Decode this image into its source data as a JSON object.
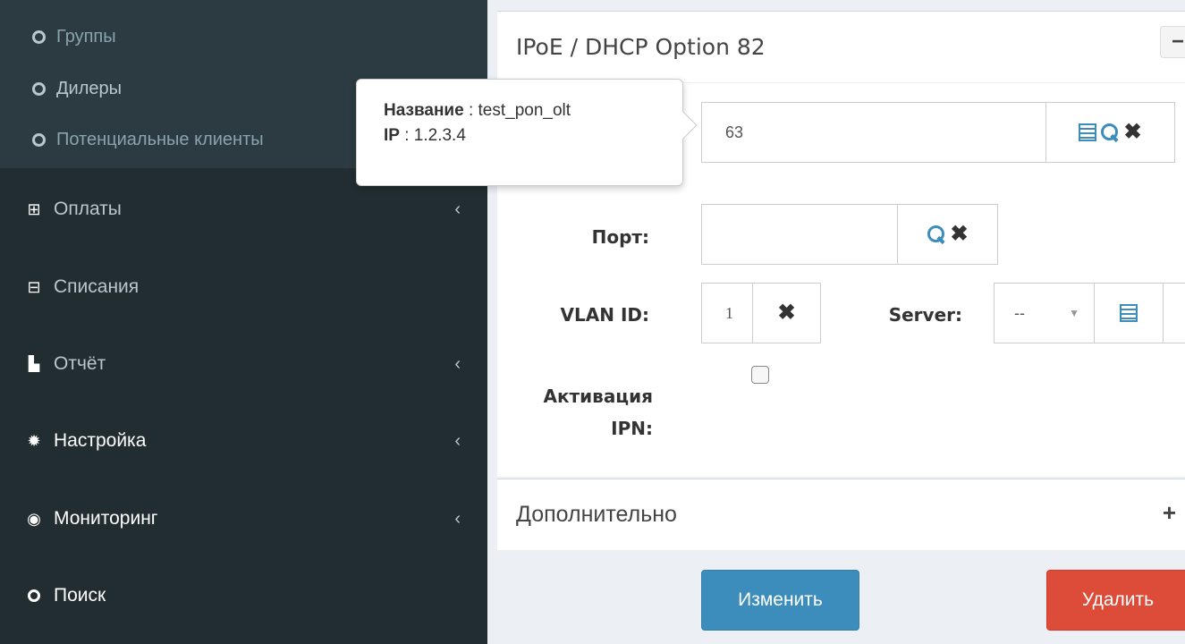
{
  "sidebar": {
    "subitems": [
      {
        "label": "Группы"
      },
      {
        "label": "Дилеры"
      },
      {
        "label": "Потенциальные клиенты"
      }
    ],
    "items": [
      {
        "label": "Оплаты",
        "icon": "plus-square-icon",
        "chevron": "‹"
      },
      {
        "label": "Списания",
        "icon": "minus-square-icon",
        "chevron": ""
      },
      {
        "label": "Отчёт",
        "icon": "bar-chart-icon",
        "chevron": "‹"
      },
      {
        "label": "Настройка",
        "icon": "gear-icon",
        "chevron": "‹"
      },
      {
        "label": "Мониторинг",
        "icon": "eye-icon",
        "chevron": "‹"
      },
      {
        "label": "Поиск",
        "icon": "search-icon",
        "chevron": ""
      }
    ]
  },
  "panel": {
    "title": "IPoE / DHCP Option 82",
    "collapse_label": "−",
    "nas_value": "63",
    "port_label": "Порт:",
    "port_value": "",
    "vlan_label": "VLAN ID:",
    "vlan_value": "1",
    "server_label": "Server:",
    "server_selected": "--",
    "activation_label_1": "Активация",
    "activation_label_2": "IPN:"
  },
  "panel2": {
    "title": "Дополнительно",
    "expand_label": "+"
  },
  "buttons": {
    "edit": "Изменить",
    "delete": "Удалить"
  },
  "tooltip": {
    "name_key": "Название",
    "name_value": " : test_pon_olt",
    "ip_key": "IP",
    "ip_value": " : 1.2.3.4"
  },
  "colors": {
    "sidebar_bg": "#222d32",
    "primary": "#3c8dbc",
    "danger": "#dd4b39"
  }
}
